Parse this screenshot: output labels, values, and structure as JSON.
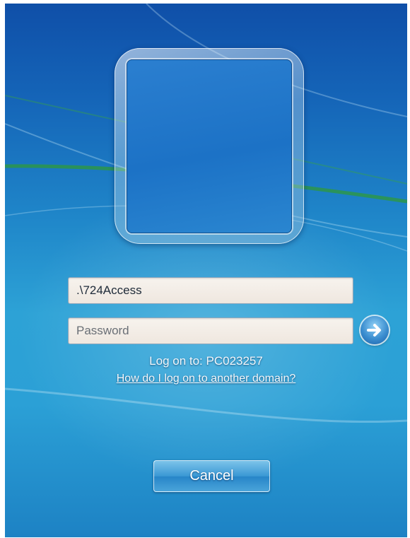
{
  "login": {
    "username_value": ".\\724Access",
    "password_placeholder": "Password",
    "logon_to": "Log on to: PC023257",
    "domain_link": "How do I log on to another domain?",
    "cancel_label": "Cancel"
  },
  "icons": {
    "submit": "arrow-right-icon",
    "user_tile": "user-tile-icon"
  },
  "colors": {
    "background": "#1f86c9",
    "streak_green": "#2f9a3a"
  }
}
